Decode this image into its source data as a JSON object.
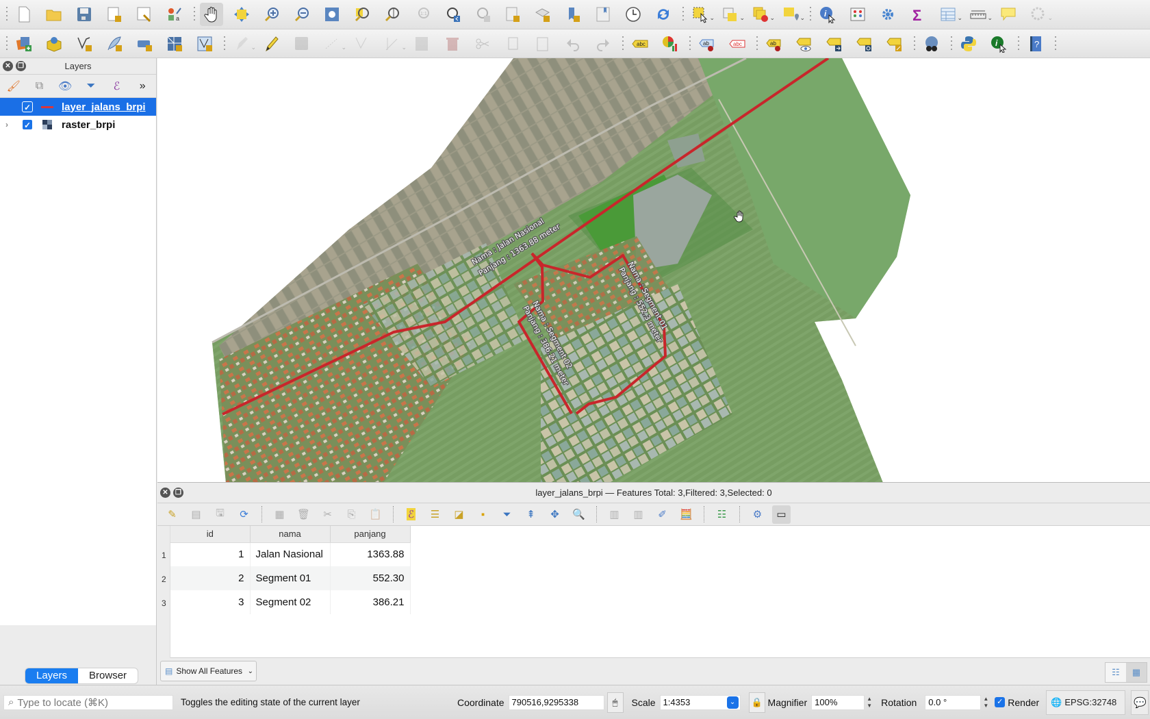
{
  "toolbar_row1": [
    {
      "name": "new-project-icon",
      "enabled": true
    },
    {
      "name": "open-project-icon",
      "enabled": true
    },
    {
      "name": "save-project-icon",
      "enabled": true
    },
    {
      "name": "new-print-layout-icon",
      "enabled": true
    },
    {
      "name": "layout-manager-icon",
      "enabled": true
    },
    {
      "name": "style-manager-icon",
      "enabled": true
    },
    {
      "name": "pan-map-icon",
      "enabled": true,
      "active": true
    },
    {
      "name": "pan-to-selection-icon",
      "enabled": true
    },
    {
      "name": "zoom-in-icon",
      "enabled": true
    },
    {
      "name": "zoom-out-icon",
      "enabled": true
    },
    {
      "name": "zoom-full-icon",
      "enabled": true
    },
    {
      "name": "zoom-to-selection-icon",
      "enabled": true
    },
    {
      "name": "zoom-to-layer-icon",
      "enabled": true
    },
    {
      "name": "zoom-native-resolution-icon",
      "enabled": false
    },
    {
      "name": "zoom-last-icon",
      "enabled": true
    },
    {
      "name": "zoom-next-icon",
      "enabled": false
    },
    {
      "name": "new-map-view-icon",
      "enabled": true
    },
    {
      "name": "new-3d-map-view-icon",
      "enabled": true
    },
    {
      "name": "new-spatial-bookmark-icon",
      "enabled": true
    },
    {
      "name": "show-bookmarks-icon",
      "enabled": true
    },
    {
      "name": "temporal-controller-icon",
      "enabled": true
    },
    {
      "name": "refresh-icon",
      "enabled": true
    },
    {
      "name": "select-features-icon",
      "enabled": true
    },
    {
      "name": "select-by-value-icon",
      "enabled": true
    },
    {
      "name": "deselect-features-icon",
      "enabled": true
    },
    {
      "name": "select-by-location-icon",
      "enabled": true
    },
    {
      "name": "identify-features-icon",
      "enabled": true
    },
    {
      "name": "field-calculator-icon",
      "enabled": true
    },
    {
      "name": "processing-toolbox-icon",
      "enabled": true
    },
    {
      "name": "statistical-summary-icon",
      "enabled": true
    },
    {
      "name": "open-attribute-table-icon",
      "enabled": true
    },
    {
      "name": "measure-line-icon",
      "enabled": true
    },
    {
      "name": "map-tips-icon",
      "enabled": true
    },
    {
      "name": "run-action-icon",
      "enabled": false
    }
  ],
  "toolbar_row2": [
    {
      "name": "data-source-manager-icon",
      "enabled": true
    },
    {
      "name": "new-geopackage-layer-icon",
      "enabled": true
    },
    {
      "name": "new-shapefile-layer-icon",
      "enabled": true
    },
    {
      "name": "new-spatialite-layer-icon",
      "enabled": true
    },
    {
      "name": "new-temporary-layer-icon",
      "enabled": true
    },
    {
      "name": "new-virtual-layer-icon",
      "enabled": true
    },
    {
      "name": "new-mesh-layer-icon",
      "enabled": true
    },
    {
      "name": "current-edits-icon",
      "enabled": false
    },
    {
      "name": "toggle-editing-icon",
      "enabled": true
    },
    {
      "name": "save-layer-edits-icon",
      "enabled": false
    },
    {
      "name": "digitize-line-icon",
      "enabled": false
    },
    {
      "name": "vertex-tool-icon",
      "enabled": false
    },
    {
      "name": "advanced-digitizing-icon",
      "enabled": false
    },
    {
      "name": "modify-attributes-icon",
      "enabled": false
    },
    {
      "name": "delete-selected-icon",
      "enabled": false
    },
    {
      "name": "cut-features-icon",
      "enabled": false
    },
    {
      "name": "copy-features-icon",
      "enabled": false
    },
    {
      "name": "paste-features-icon",
      "enabled": false
    },
    {
      "name": "undo-icon",
      "enabled": false
    },
    {
      "name": "redo-icon",
      "enabled": false
    },
    {
      "name": "layer-labeling-icon",
      "enabled": true
    },
    {
      "name": "layer-diagram-icon",
      "enabled": true
    },
    {
      "name": "pin-unpin-labels-icon",
      "enabled": true
    },
    {
      "name": "highlight-pinned-labels-icon",
      "enabled": true
    },
    {
      "name": "pin-labels-icon",
      "enabled": true
    },
    {
      "name": "show-hide-labels-icon",
      "enabled": true
    },
    {
      "name": "move-label-icon",
      "enabled": true
    },
    {
      "name": "rotate-label-icon",
      "enabled": true
    },
    {
      "name": "change-label-properties-icon",
      "enabled": true
    },
    {
      "name": "metasearch-icon",
      "enabled": true
    },
    {
      "name": "python-console-icon",
      "enabled": true
    },
    {
      "name": "identify-plugin-icon",
      "enabled": true
    },
    {
      "name": "help-icon",
      "enabled": true
    }
  ],
  "layers_panel": {
    "title": "Layers",
    "layers": [
      {
        "name": "layer_jalans_brpi",
        "checked": true,
        "selected": true,
        "type": "line",
        "symbol_color": "#d9363b"
      },
      {
        "name": "raster_brpi",
        "checked": true,
        "selected": false,
        "type": "raster"
      }
    ],
    "tabs": [
      "Layers",
      "Browser"
    ],
    "active_tab": "Layers"
  },
  "map": {
    "labels": [
      {
        "line1": "Nama : Jalan Nasional",
        "line2": "Panjang : 1363.88 meter"
      },
      {
        "line1": "Nama : Segment 01",
        "line2": "Panjang : 552.3 meter"
      },
      {
        "line1": "Nama : Segment 02",
        "line2": "Panjang : 386.21 meter"
      }
    ],
    "line_color": "#c8262b"
  },
  "attribute_table": {
    "title": "layer_jalans_brpi — Features Total: 3,Filtered: 3,Selected: 0",
    "columns": [
      "id",
      "nama",
      "panjang"
    ],
    "rows": [
      {
        "n": "1",
        "id": "1",
        "nama": "Jalan Nasional",
        "panjang": "1363.88"
      },
      {
        "n": "2",
        "id": "2",
        "nama": "Segment 01",
        "panjang": "552.30"
      },
      {
        "n": "3",
        "id": "3",
        "nama": "Segment 02",
        "panjang": "386.21"
      }
    ],
    "filter_button": "Show All Features"
  },
  "status": {
    "locate_placeholder": "Type to locate (⌘K)",
    "message": "Toggles the editing state of the current layer",
    "coordinate_label": "Coordinate",
    "coordinate": "790516,9295338",
    "scale_label": "Scale",
    "scale": "1:4353",
    "magnifier_label": "Magnifier",
    "magnifier": "100%",
    "rotation_label": "Rotation",
    "rotation": "0.0 °",
    "render_label": "Render",
    "render_checked": true,
    "crs": "EPSG:32748"
  }
}
